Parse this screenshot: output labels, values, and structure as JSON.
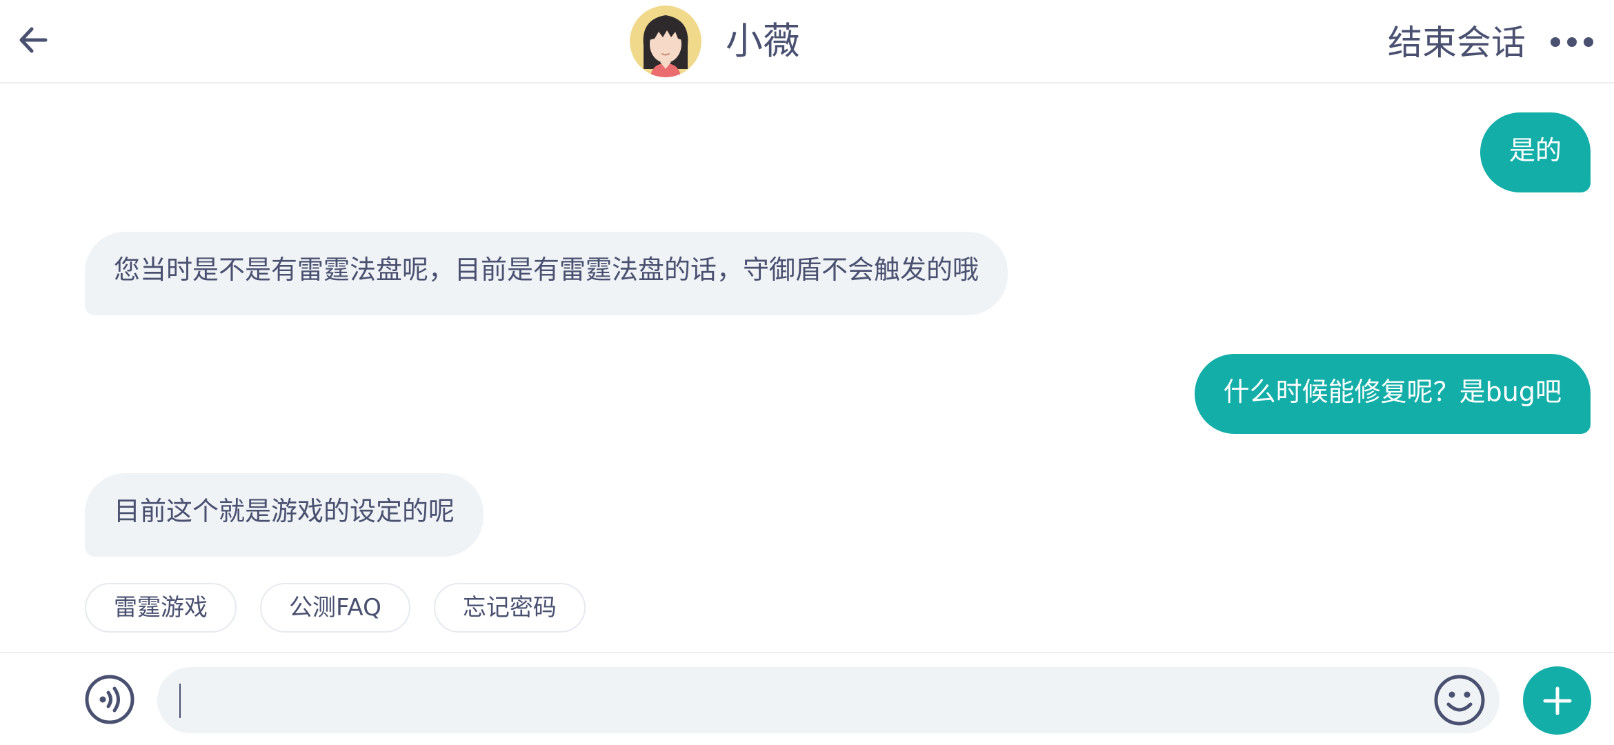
{
  "header": {
    "agent_name": "小薇",
    "end_session_label": "结束会话",
    "icons": {
      "back": "arrow-left-icon",
      "avatar": "agent-avatar",
      "more": "more-dots-icon"
    }
  },
  "messages": [
    {
      "direction": "out",
      "text": "是的"
    },
    {
      "direction": "in",
      "text": "您当时是不是有雷霆法盘呢，目前是有雷霆法盘的话，守御盾不会触发的哦"
    },
    {
      "direction": "out",
      "text": "什么时候能修复呢？是bug吧"
    },
    {
      "direction": "in",
      "text": "目前这个就是游戏的设定的呢"
    }
  ],
  "quick_replies": [
    "雷霆游戏",
    "公测FAQ",
    "忘记密码"
  ],
  "input": {
    "value": "",
    "placeholder": ""
  },
  "colors": {
    "accent": "#12aea7",
    "incoming_bubble": "#f0f3f6",
    "text": "#4a5070"
  }
}
